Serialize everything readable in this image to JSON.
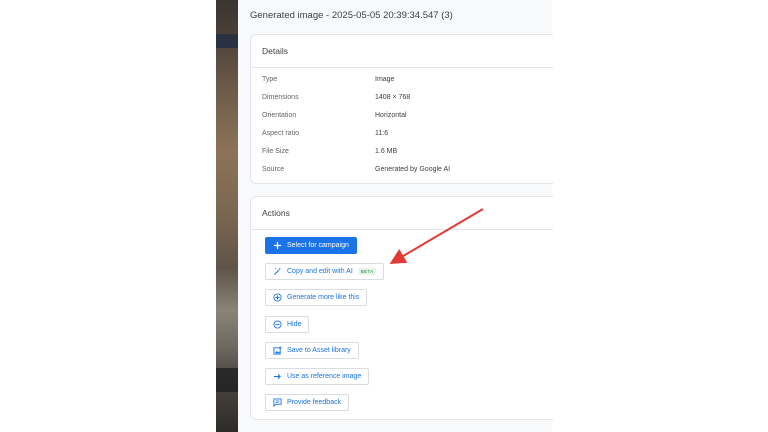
{
  "panel": {
    "title": "Generated image - 2025-05-05 20:39:34.547 (3)"
  },
  "details": {
    "heading": "Details",
    "rows": [
      {
        "key": "Type",
        "value": "Image"
      },
      {
        "key": "Dimensions",
        "value": "1408 × 768"
      },
      {
        "key": "Orientation",
        "value": "Horizontal"
      },
      {
        "key": "Aspect ratio",
        "value": "11:6"
      },
      {
        "key": "File Size",
        "value": "1.6 MB"
      },
      {
        "key": "Source",
        "value": "Generated by Google AI"
      }
    ]
  },
  "actions": {
    "heading": "Actions",
    "buttons": [
      {
        "label": "Select for campaign",
        "icon": "plus-icon"
      },
      {
        "label": "Copy and edit with AI",
        "icon": "magic-wand-icon",
        "badge": "BETA"
      },
      {
        "label": "Generate more like this",
        "icon": "add-circle-icon"
      },
      {
        "label": "Hide",
        "icon": "minus-circle-icon"
      },
      {
        "label": "Save to Asset library",
        "icon": "image-add-icon"
      },
      {
        "label": "Use as reference image",
        "icon": "arrow-right-icon"
      },
      {
        "label": "Provide feedback",
        "icon": "feedback-icon"
      }
    ]
  },
  "colors": {
    "accent": "#1a73e8",
    "annotation": "#e53935",
    "beta_text": "#188038"
  }
}
